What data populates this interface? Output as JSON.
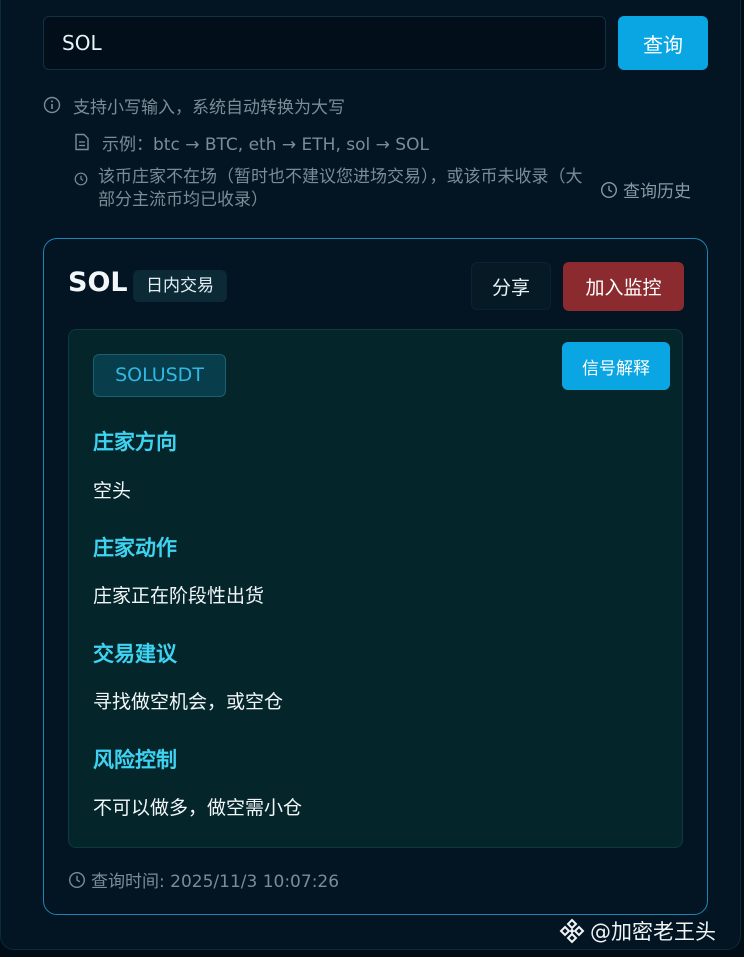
{
  "search": {
    "value": "SOL",
    "button": "查询"
  },
  "hints": {
    "info": "支持小写输入，系统自动转换为大写",
    "example": "示例：btc → BTC, eth → ETH, sol → SOL",
    "notice": "该币庄家不在场（暂时也不建议您进场交易），或该币未收录（大部分主流币均已收录）",
    "history": "查询历史"
  },
  "result": {
    "coin": "SOL",
    "type_tag": "日内交易",
    "share": "分享",
    "monitor": "加入监控",
    "symbol": "SOLUSDT",
    "explain": "信号解释",
    "sections": [
      {
        "title": "庄家方向",
        "value": "空头"
      },
      {
        "title": "庄家动作",
        "value": "庄家正在阶段性出货"
      },
      {
        "title": "交易建议",
        "value": "寻找做空机会，或空仓"
      },
      {
        "title": "风险控制",
        "value": "不可以做多，做空需小仓"
      }
    ],
    "query_time": "查询时间: 2025/11/3 10:07:26"
  },
  "watermark": "@加密老王头",
  "colors": {
    "accent": "#0aa6e3",
    "danger": "#8b2b30",
    "section_title": "#3fd3f2"
  }
}
